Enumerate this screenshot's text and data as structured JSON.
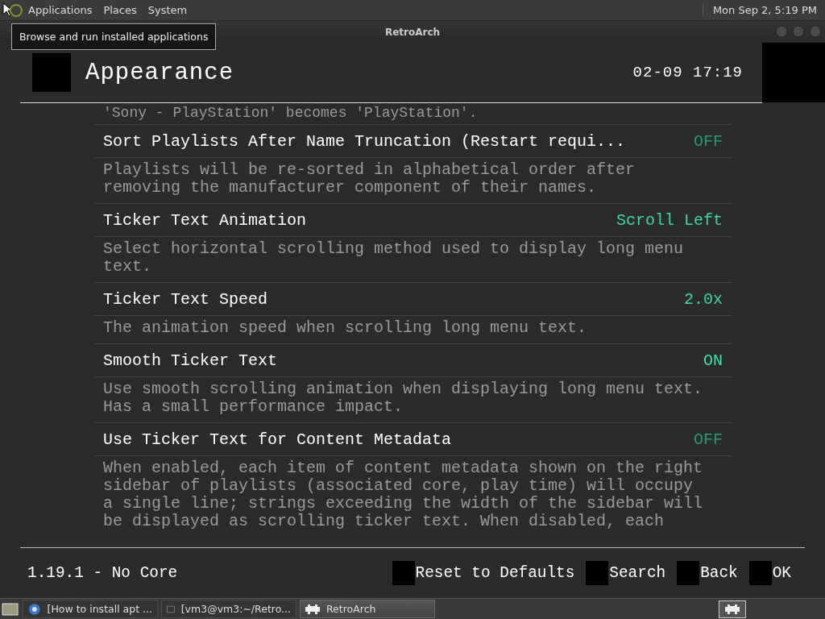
{
  "top_panel": {
    "menus": [
      "Applications",
      "Places",
      "System"
    ],
    "clock": "Mon Sep  2, 5:19 PM"
  },
  "tooltip": "Browse and run installed applications",
  "window": {
    "title": "RetroArch"
  },
  "header": {
    "title": "Appearance",
    "clock": "02-09 17:19"
  },
  "intro": "'Sony - PlayStation' becomes 'PlayStation'.",
  "settings": [
    {
      "label": "Sort Playlists After Name Truncation (Restart requi...",
      "kind": "toggle",
      "on": false,
      "value": "OFF",
      "description": "Playlists will be re-sorted in alphabetical order after removing the manufacturer component of their names."
    },
    {
      "label": "Ticker Text Animation",
      "kind": "choice",
      "value": "Scroll Left",
      "description": "Select horizontal scrolling method used to display long menu text."
    },
    {
      "label": "Ticker Text Speed",
      "kind": "choice",
      "value": "2.0x",
      "description": "The animation speed when scrolling long menu text."
    },
    {
      "label": "Smooth Ticker Text",
      "kind": "toggle",
      "on": true,
      "value": "ON",
      "description": "Use smooth scrolling animation when displaying long menu text. Has a small performance impact."
    },
    {
      "label": "Use Ticker Text for Content Metadata",
      "kind": "toggle",
      "on": false,
      "value": "OFF",
      "description": "When enabled, each item of content metadata shown on the right sidebar of playlists (associated core, play time) will occupy a single line; strings exceeding the width of the sidebar will be displayed as scrolling ticker text. When disabled, each"
    }
  ],
  "footer": {
    "version": "1.19.1 - No Core",
    "actions": [
      "Reset to Defaults",
      "Search",
      "Back",
      "OK"
    ]
  },
  "taskbar": {
    "tasks": [
      {
        "label": "[How to install apt ...",
        "selected": false
      },
      {
        "label": "[vm3@vm3:~/Retro...",
        "selected": false
      },
      {
        "label": "RetroArch",
        "selected": true
      }
    ]
  }
}
